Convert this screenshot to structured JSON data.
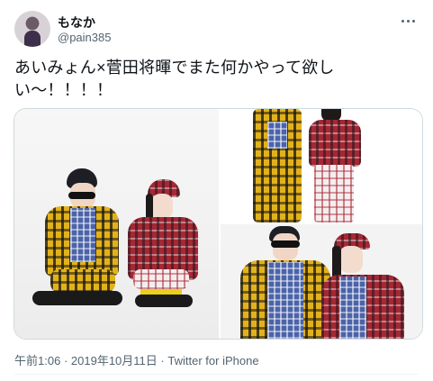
{
  "author": {
    "name": "もなか",
    "handle": "@pain385",
    "avatar_icon": "user-avatar"
  },
  "tweet": {
    "text": "あいみょん×菅田将暉でまた何かやって欲しい〜！！！！"
  },
  "media": {
    "photo_count": 3
  },
  "meta": {
    "time": "午前1:06",
    "separator1": "·",
    "date": "2019年10月11日",
    "separator2": "·",
    "source": "Twitter for iPhone"
  },
  "colors": {
    "text": "#0f1419",
    "secondary": "#536471",
    "border": "#cfd9de"
  },
  "icons": {
    "more": "more-horizontal-icon"
  }
}
